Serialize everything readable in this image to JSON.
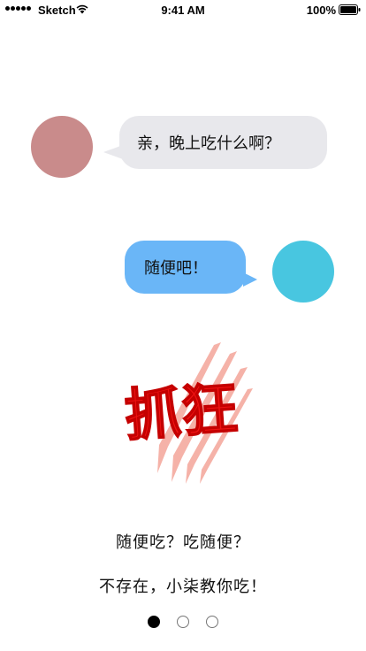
{
  "status_bar": {
    "carrier": "Sketch",
    "time": "9:41 AM",
    "battery": "100%",
    "signal_dots": 5
  },
  "colors": {
    "left_avatar": "#c98b8b",
    "right_avatar": "#48c6e0",
    "left_bubble": "#e8e8ec",
    "right_bubble": "#6ab6f7",
    "mad_text": "#f01414",
    "claw_marks": "#f4a59a"
  },
  "chat": {
    "left_message": "亲，晚上吃什么啊？",
    "right_message": "随便吧！"
  },
  "illustration": {
    "text": "抓狂",
    "icon": "claw-scratch-icon"
  },
  "captions": {
    "line1": "随便吃？吃随便？",
    "line2": "不存在，小柒教你吃！"
  },
  "pager": {
    "count": 3,
    "active_index": 0
  }
}
